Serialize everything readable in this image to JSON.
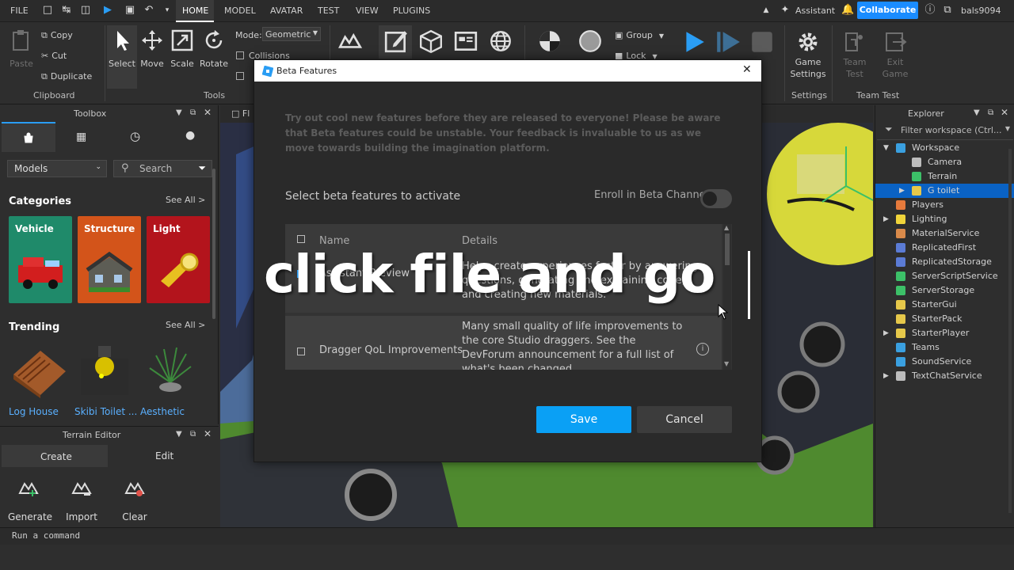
{
  "menubar": {
    "file": "FILE",
    "tabs": [
      "HOME",
      "MODEL",
      "AVATAR",
      "TEST",
      "VIEW",
      "PLUGINS"
    ],
    "assistant": "Assistant",
    "collaborate": "Collaborate",
    "username": "bals9094"
  },
  "ribbon": {
    "paste": "Paste",
    "copy": "Copy",
    "cut": "Cut",
    "duplicate": "Duplicate",
    "clipboard": "Clipboard",
    "select": "Select",
    "move": "Move",
    "scale": "Scale",
    "rotate": "Rotate",
    "tools": "Tools",
    "mode_label": "Mode:",
    "mode_value": "Geometric",
    "collisions": "Collisions",
    "group": "Group",
    "lock": "Lock",
    "game_settings_1": "Game",
    "game_settings_2": "Settings",
    "settings_group": "Settings",
    "team_test_1": "Team",
    "team_test_2": "Test",
    "exit_game_1": "Exit",
    "exit_game_2": "Game",
    "team_test_group": "Team Test"
  },
  "toolbox": {
    "title": "Toolbox",
    "category_select": "Models",
    "search_placeholder": "Search",
    "categories_heading": "Categories",
    "see_all": "See All >",
    "categories": [
      {
        "label": "Vehicle",
        "color": "#1f8a6a"
      },
      {
        "label": "Structure",
        "color": "#d3541a"
      },
      {
        "label": "Light",
        "color": "#b3141c"
      }
    ],
    "trending_heading": "Trending",
    "trending_see_all": "See All >",
    "trending": [
      "Log House",
      "Skibi Toilet ...",
      "Aesthetic"
    ]
  },
  "terrain_editor": {
    "title": "Terrain Editor",
    "tabs": [
      "Create",
      "Edit"
    ],
    "tools": [
      "Generate",
      "Import",
      "Clear"
    ]
  },
  "viewport": {
    "tab_label": "Fl"
  },
  "explorer": {
    "title": "Explorer",
    "filter_placeholder": "Filter workspace (Ctrl...",
    "items": [
      {
        "label": "Workspace",
        "color": "#3aa0e0"
      },
      {
        "label": "Camera",
        "color": "#bdbdbd"
      },
      {
        "label": "Terrain",
        "color": "#3cc068"
      },
      {
        "label": "G toilet",
        "color": "#e6c84a"
      },
      {
        "label": "Players",
        "color": "#e67a3c"
      },
      {
        "label": "Lighting",
        "color": "#f0d43a"
      },
      {
        "label": "MaterialService",
        "color": "#d98a4a"
      },
      {
        "label": "ReplicatedFirst",
        "color": "#5b7bd5"
      },
      {
        "label": "ReplicatedStorage",
        "color": "#5b7bd5"
      },
      {
        "label": "ServerScriptService",
        "color": "#3cc068"
      },
      {
        "label": "ServerStorage",
        "color": "#3cc068"
      },
      {
        "label": "StarterGui",
        "color": "#e6c84a"
      },
      {
        "label": "StarterPack",
        "color": "#e6c84a"
      },
      {
        "label": "StarterPlayer",
        "color": "#e6c84a"
      },
      {
        "label": "Teams",
        "color": "#3aa0e0"
      },
      {
        "label": "SoundService",
        "color": "#3aa0e0"
      },
      {
        "label": "TextChatService",
        "color": "#bdbdbd"
      }
    ]
  },
  "dialog": {
    "title": "Beta Features",
    "description": "Try out cool new features before they are released to everyone! Please be aware that Beta features could be unstable. Your feedback is invaluable to us as we move towards building the imagination platform.",
    "select_label": "Select beta features to activate",
    "enroll_label": "Enroll in Beta Channel",
    "col_name": "Name",
    "col_details": "Details",
    "row1_name": "Assistant Preview",
    "row1_details": "Helps create experiences faster by answering questions, generating and explaining code, and creating new materials.",
    "row2_name": "Dragger QoL Improvements",
    "row2_details": "Many small quality of life improvements to the core Studio draggers. See the DevForum announcement for a full list of what's been changed.",
    "save": "Save",
    "cancel": "Cancel"
  },
  "caption": "click file and go",
  "command_bar": {
    "placeholder": "Run a command"
  }
}
